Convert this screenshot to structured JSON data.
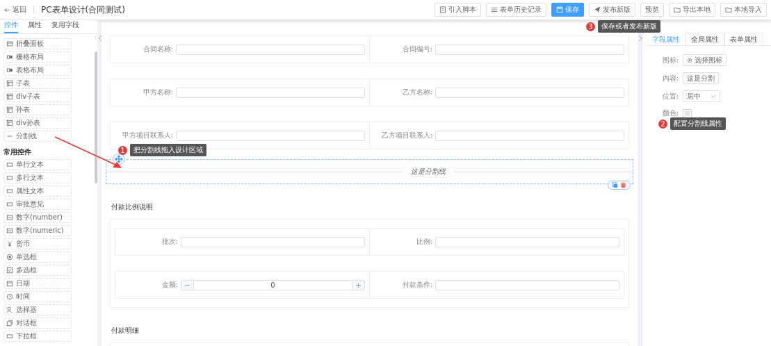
{
  "header": {
    "back": "返回",
    "title": "PC表单设计(合同测试)",
    "buttons": [
      {
        "label": "引入脚本",
        "primary": false
      },
      {
        "label": "表单历史记录",
        "primary": false
      },
      {
        "label": "保存",
        "primary": true
      },
      {
        "label": "发布新版",
        "primary": false
      },
      {
        "label": "预览",
        "primary": false
      },
      {
        "label": "导出本地",
        "primary": false
      },
      {
        "label": "本地导入",
        "primary": false
      }
    ]
  },
  "left_panel": {
    "tabs": [
      {
        "label": "控件",
        "selected": true
      },
      {
        "label": "属性",
        "selected": false
      },
      {
        "label": "复用字段",
        "selected": false
      }
    ],
    "layout_items": [
      {
        "label": "折叠面板"
      },
      {
        "label": "栅格布局"
      },
      {
        "label": "表格布局"
      },
      {
        "label": "子表"
      },
      {
        "label": "div子表"
      },
      {
        "label": "孙表"
      },
      {
        "label": "div孙表"
      },
      {
        "label": "分割线"
      }
    ],
    "section_title": "常用控件",
    "common_items": [
      {
        "label": "单行文本"
      },
      {
        "label": "多行文本"
      },
      {
        "label": "属性文本"
      },
      {
        "label": "审批意见"
      },
      {
        "label": "数字(number)"
      },
      {
        "label": "数字(numeric)"
      },
      {
        "label": "货币"
      },
      {
        "label": "单选框"
      },
      {
        "label": "多选框"
      },
      {
        "label": "日期"
      },
      {
        "label": "时间"
      },
      {
        "label": "选择器"
      },
      {
        "label": "对话框"
      },
      {
        "label": "下拉框"
      }
    ]
  },
  "canvas": {
    "rows": [
      [
        {
          "label": "合同名称:",
          "kind": "text"
        },
        {
          "label": "合同编号:",
          "kind": "text"
        }
      ],
      [
        {
          "label": "甲方名称:",
          "kind": "text"
        },
        {
          "label": "乙方名称:",
          "kind": "text"
        }
      ],
      [
        {
          "label": "甲方项目联系人:",
          "kind": "text"
        },
        {
          "label": "乙方项目联系人:",
          "kind": "text"
        }
      ]
    ],
    "divider": {
      "text": "这是分割线"
    },
    "sections": [
      {
        "title": "付款比例说明",
        "rows": [
          [
            {
              "label": "批次:",
              "kind": "text"
            },
            {
              "label": "比例:",
              "kind": "text"
            }
          ],
          [
            {
              "label": "金额:",
              "kind": "number",
              "value": "0",
              "minus": "−",
              "plus": "+"
            },
            {
              "label": "付款条件:",
              "kind": "text"
            }
          ]
        ]
      },
      {
        "title": "付款明细"
      }
    ]
  },
  "right_panel": {
    "tabs": [
      {
        "label": "字段属性",
        "selected": true
      },
      {
        "label": "全局属性",
        "selected": false
      },
      {
        "label": "表单属性",
        "selected": false
      }
    ],
    "properties": [
      {
        "label": "图标:",
        "kind": "button",
        "value": "选择图标"
      },
      {
        "label": "内容:",
        "kind": "text",
        "value": "这是分割"
      },
      {
        "label": "位置:",
        "kind": "select",
        "value": "居中"
      },
      {
        "label": "颜色:",
        "kind": "color"
      }
    ]
  },
  "annotations": [
    {
      "number": "1",
      "text": "把分割线拖入设计区域"
    },
    {
      "number": "2",
      "text": "配置分割线属性"
    },
    {
      "number": "3",
      "text": "保存或者发布新版"
    }
  ]
}
